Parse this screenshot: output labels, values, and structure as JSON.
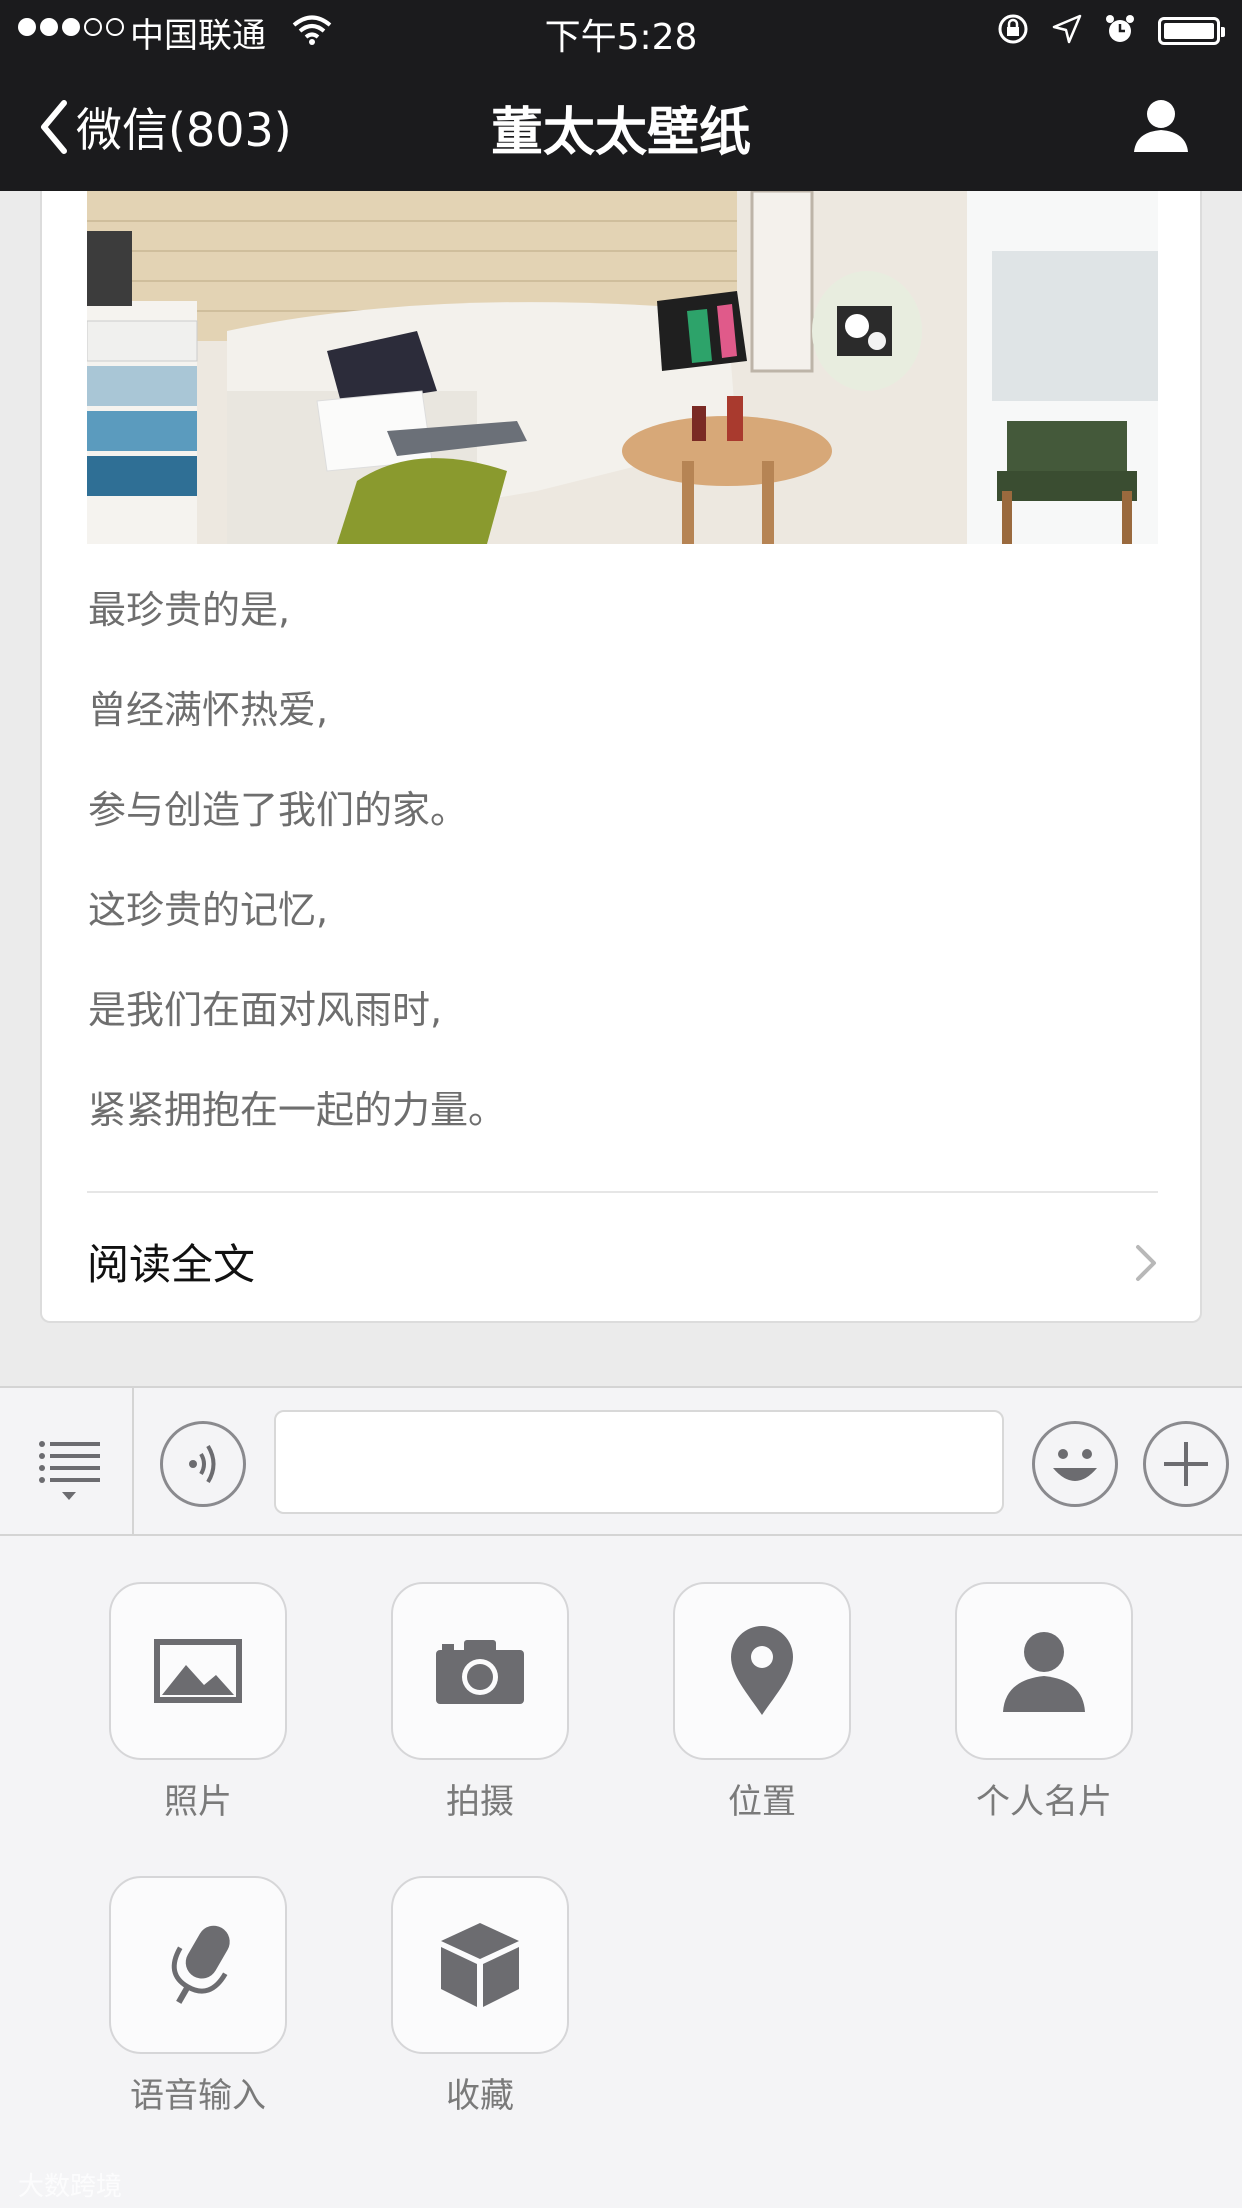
{
  "status_bar": {
    "carrier": "中国联通",
    "time": "下午5:28"
  },
  "nav": {
    "back_label": "微信(803)",
    "title": "董太太壁纸"
  },
  "article": {
    "lines": [
      "最珍贵的是,",
      "曾经满怀热爱,",
      "参与创造了我们的家。",
      "这珍贵的记忆,",
      "是我们在面对风雨时,",
      "紧紧拥抱在一起的力量。"
    ],
    "read_more": "阅读全文"
  },
  "input_bar": {
    "text_value": ""
  },
  "panel": {
    "items": [
      {
        "label": "照片",
        "icon": "photo-icon"
      },
      {
        "label": "拍摄",
        "icon": "camera-icon"
      },
      {
        "label": "位置",
        "icon": "location-icon"
      },
      {
        "label": "个人名片",
        "icon": "contact-card-icon"
      },
      {
        "label": "语音输入",
        "icon": "microphone-icon"
      },
      {
        "label": "收藏",
        "icon": "favorites-box-icon"
      }
    ]
  },
  "watermark": "大数跨境",
  "colors": {
    "top_bar": "#1b1b1d",
    "background": "#ebebeb",
    "panel": "#f4f4f6",
    "icon_gray": "#6c6c70"
  }
}
